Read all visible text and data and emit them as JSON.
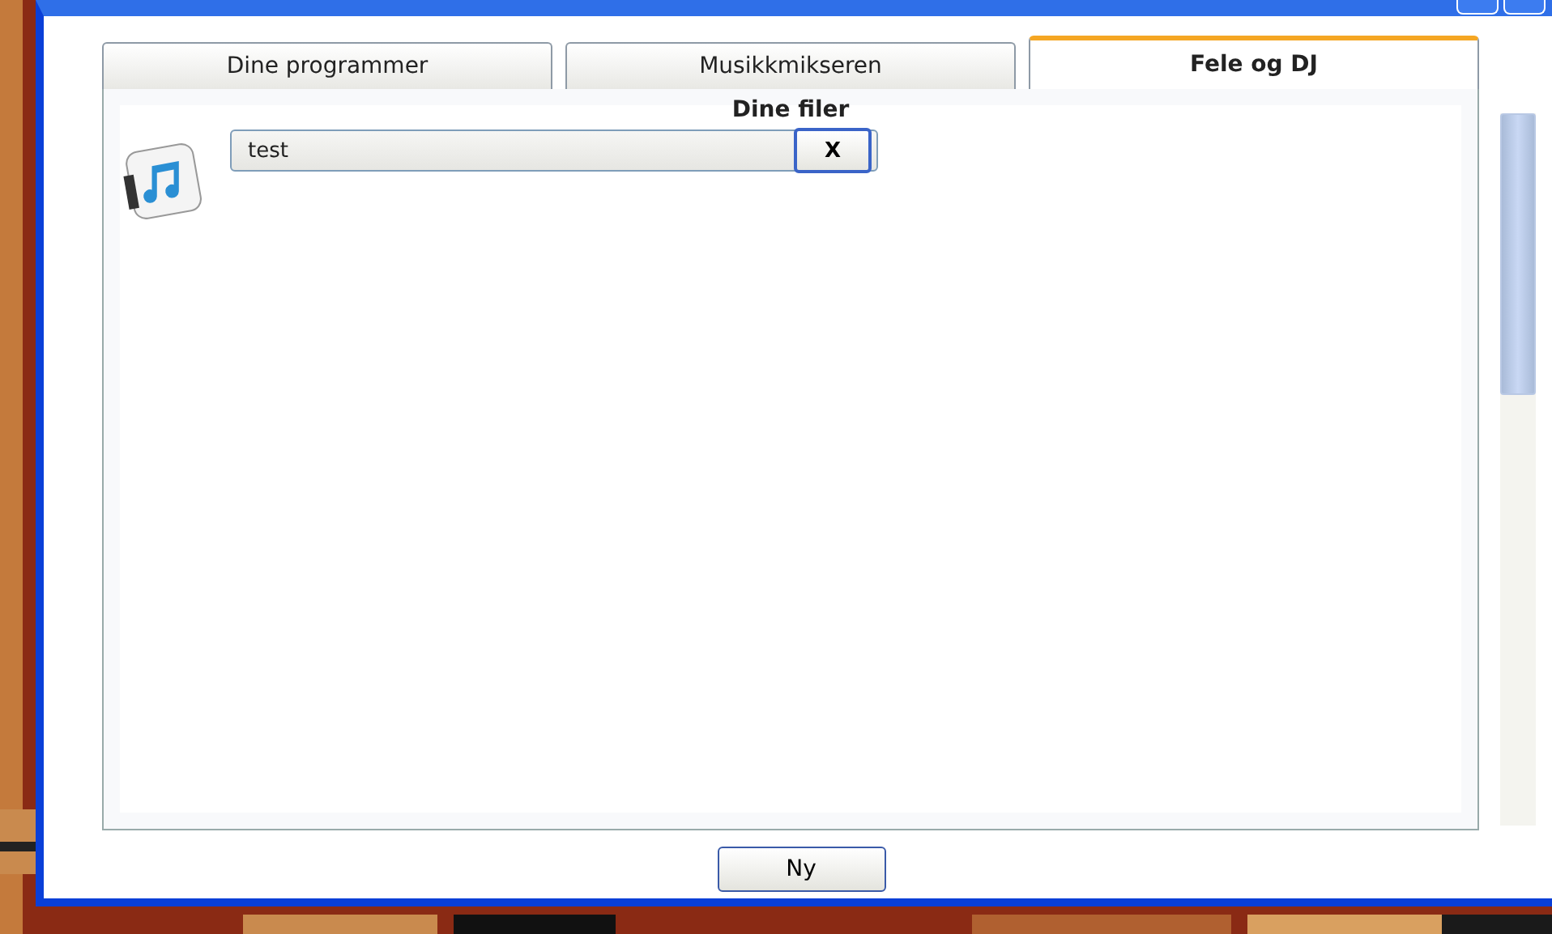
{
  "tabs": [
    {
      "label": "Dine programmer",
      "selected": false
    },
    {
      "label": "Musikkmikseren",
      "selected": false
    },
    {
      "label": "Fele og DJ",
      "selected": true
    }
  ],
  "panel": {
    "heading": "Dine filer",
    "files": [
      {
        "name": "test",
        "delete_label": "X"
      }
    ]
  },
  "buttons": [
    {
      "label": "Ny"
    }
  ]
}
